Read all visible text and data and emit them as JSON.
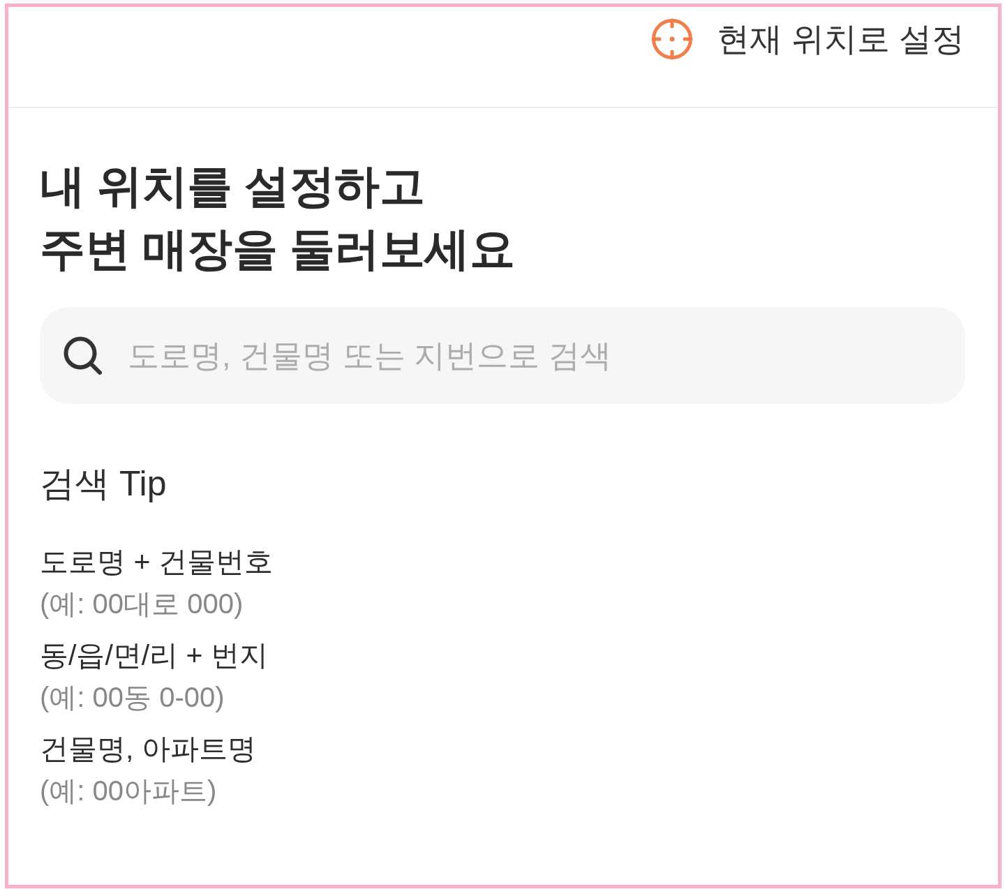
{
  "header": {
    "locate_button": {
      "label": "현재 위치로 설정"
    }
  },
  "intro": {
    "title": "내 위치를 설정하고\n주변 매장을 둘러보세요"
  },
  "search": {
    "placeholder": "도로명, 건물명 또는 지번으로 검색"
  },
  "tips": {
    "title": "검색 Tip",
    "items": [
      {
        "label": "도로명 + 건물번호",
        "example": "(예: 00대로 000)"
      },
      {
        "label": "동/읍/면/리 + 번지",
        "example": "(예: 00동 0-00)"
      },
      {
        "label": "건물명, 아파트명",
        "example": "(예: 00아파트)"
      }
    ]
  }
}
